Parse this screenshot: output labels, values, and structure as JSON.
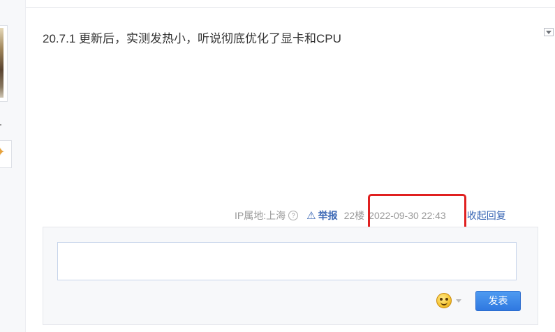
{
  "post": {
    "content": "20.7.1 更新后，实测发热小，听说彻底优化了显卡和CPU"
  },
  "tail": {
    "ip_location": "IP属地:上海",
    "help_glyph": "?",
    "report_label": "举报",
    "floor": "22楼",
    "time": "2022-09-30 22:43",
    "collapse_label": "收起回复"
  },
  "reply": {
    "input_value": "",
    "submit_label": "发表"
  },
  "icons": {
    "report": "warning-triangle-icon",
    "help": "question-circle-icon",
    "emoji": "smiley-face-icon",
    "menu": "dropdown-arrow-icon"
  },
  "colors": {
    "link": "#3a67b5",
    "highlight": "#e02020",
    "submit": "#3385ff"
  }
}
